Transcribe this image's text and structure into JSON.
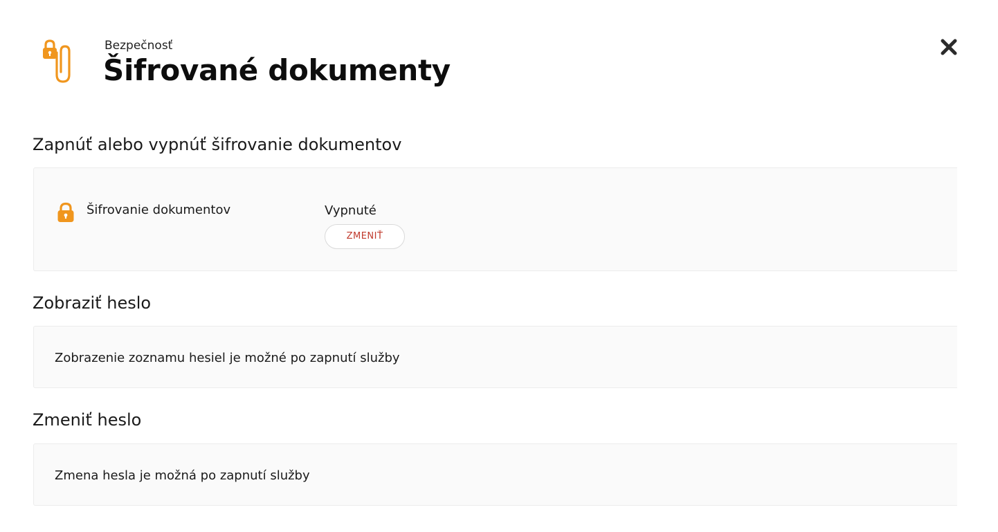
{
  "header": {
    "eyebrow": "Bezpečnosť",
    "title": "Šifrované dokumenty",
    "icon": "paperclip-lock-icon",
    "close_icon": "close-icon"
  },
  "sections": {
    "encryption": {
      "title": "Zapnúť alebo vypnúť šifrovanie dokumentov",
      "setting_label": "Šifrovanie dokumentov",
      "setting_icon": "lock-icon",
      "state": "Vypnuté",
      "change_button": "ZMENIŤ"
    },
    "show_password": {
      "title": "Zobraziť heslo",
      "message": "Zobrazenie zoznamu hesiel je možné po zapnutí služby"
    },
    "change_password": {
      "title": "Zmeniť heslo",
      "message": "Zmena hesla je možná po zapnutí služby"
    }
  },
  "colors": {
    "accent_orange": "#f0961e",
    "button_text": "#c0392b",
    "panel_bg": "#fafafa"
  }
}
